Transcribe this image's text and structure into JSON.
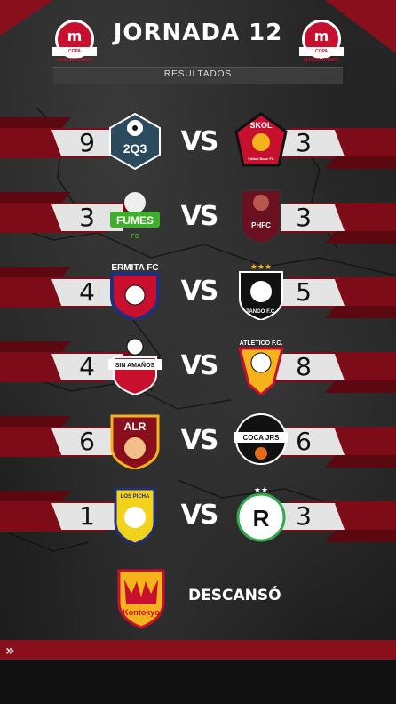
{
  "header": {
    "title": "JORNADA 12",
    "subtitle": "RESULTADOS",
    "brand_letter": "m",
    "brand_tag": "COPA MASCONTANDO"
  },
  "matches": [
    {
      "home_score": "9",
      "away_score": "3",
      "home_label": "2Q3",
      "away_label": "SKOL",
      "away_sub": "Fútbol Base FC",
      "vs": "VS"
    },
    {
      "home_score": "3",
      "away_score": "3",
      "home_label": "FUMES",
      "home_sub": "FC",
      "away_label": "PHFC",
      "vs": "VS"
    },
    {
      "home_score": "4",
      "away_score": "5",
      "home_label": "ERMITA FC",
      "away_label": "TANGO F.C.",
      "vs": "VS"
    },
    {
      "home_score": "4",
      "away_score": "8",
      "home_label": "SIN AMAÑOS",
      "away_label": "ATLETICO F.C.",
      "vs": "VS"
    },
    {
      "home_score": "6",
      "away_score": "6",
      "home_label": "ALR",
      "away_label": "COCA JRS",
      "vs": "VS"
    },
    {
      "home_score": "1",
      "away_score": "3",
      "home_label": "LOS PICHA",
      "away_label": "R",
      "vs": "VS"
    }
  ],
  "bye": {
    "team_label": "Kontokyo",
    "text": "DESCANSÓ"
  },
  "footer": {
    "chevrons": "»"
  },
  "colors": {
    "accent_red": "#8a0f1c",
    "brand_red": "#c8102e",
    "score_bg": "#e4e4e4"
  }
}
